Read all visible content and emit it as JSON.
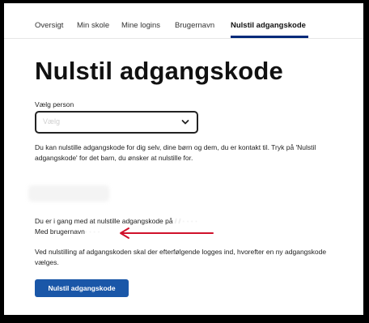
{
  "nav": {
    "tabs": [
      {
        "label": "Oversigt"
      },
      {
        "label": "Min skole"
      },
      {
        "label": "Mine logins"
      },
      {
        "label": "Brugernavn"
      },
      {
        "label": "Nulstil adgangskode"
      }
    ],
    "active_tab": "Nulstil adgangskode"
  },
  "page": {
    "title": "Nulstil adgangskode"
  },
  "person_select": {
    "label": "Vælg person",
    "value": "Vælg"
  },
  "info_text": "Du kan nulstille adgangskode for dig selv, dine børn og dem, du er kontakt til. Tryk på 'Nulstil adgangskode' for det barn, du ønsker at nulstille for.",
  "status": {
    "line1_prefix": "Du er i gang med at nulstille adgangskode på",
    "line1_redacted": "/ / · · · ·",
    "line2_prefix": "Med brugernavn",
    "line2_redacted": "· · · ·"
  },
  "notice_text": "Ved nulstilling af adgangskoden skal der efterfølgende logges ind, hvorefter en ny adgangskode vælges.",
  "primary_button": {
    "label": "Nulstil adgangskode"
  },
  "colors": {
    "accent": "#1a57a8",
    "nav_underline": "#002a7a",
    "annotation_arrow": "#d0112b",
    "frame": "#000000"
  },
  "icons": {
    "select_arrow": "chevron-down-icon",
    "annotation": "red-arrow-icon"
  }
}
